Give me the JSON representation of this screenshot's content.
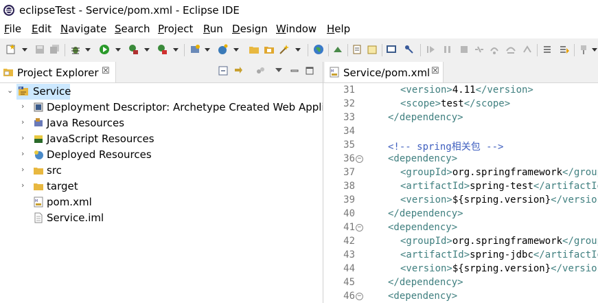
{
  "window": {
    "title": "eclipseTest - Service/pom.xml - Eclipse IDE"
  },
  "menu": [
    "File",
    "Edit",
    "Navigate",
    "Search",
    "Project",
    "Run",
    "Design",
    "Window",
    "Help"
  ],
  "project_explorer": {
    "tab_label": "Project Explorer",
    "close_glyph": "☒",
    "tree": [
      {
        "label": "Service",
        "icon": "maven-project-icon",
        "expanded": true,
        "selected": true
      },
      {
        "label": "Deployment Descriptor: Archetype Created Web Application",
        "icon": "deployment-descriptor-icon"
      },
      {
        "label": "Java Resources",
        "icon": "java-resources-icon"
      },
      {
        "label": "JavaScript Resources",
        "icon": "javascript-resources-icon"
      },
      {
        "label": "Deployed Resources",
        "icon": "deployed-resources-icon"
      },
      {
        "label": "src",
        "icon": "folder-icon"
      },
      {
        "label": "target",
        "icon": "folder-icon"
      },
      {
        "label": "pom.xml",
        "icon": "maven-file-icon"
      },
      {
        "label": "Service.iml",
        "icon": "file-icon"
      }
    ]
  },
  "editor": {
    "tab_label": "Service/pom.xml",
    "close_glyph": "☒",
    "lines": [
      {
        "num": "31",
        "fold": false,
        "indent": "  ",
        "parts": [
          [
            "tag",
            "<version>"
          ],
          [
            "txt",
            "4.11"
          ],
          [
            "tag",
            "</version>"
          ]
        ]
      },
      {
        "num": "32",
        "fold": false,
        "indent": "  ",
        "parts": [
          [
            "tag",
            "<scope>"
          ],
          [
            "txt",
            "test"
          ],
          [
            "tag",
            "</scope>"
          ]
        ]
      },
      {
        "num": "33",
        "fold": false,
        "indent": "",
        "parts": [
          [
            "tag",
            "</dependency>"
          ]
        ]
      },
      {
        "num": "34",
        "fold": false,
        "indent": "",
        "parts": []
      },
      {
        "num": "35",
        "fold": false,
        "indent": "",
        "parts": [
          [
            "cmt",
            "<!-- spring相关包 -->"
          ]
        ]
      },
      {
        "num": "36",
        "fold": true,
        "indent": "",
        "parts": [
          [
            "tag",
            "<dependency>"
          ]
        ]
      },
      {
        "num": "37",
        "fold": false,
        "indent": "  ",
        "parts": [
          [
            "tag",
            "<groupId>"
          ],
          [
            "txt",
            "org.springframework"
          ],
          [
            "tag",
            "</groupId>"
          ]
        ]
      },
      {
        "num": "38",
        "fold": false,
        "indent": "  ",
        "parts": [
          [
            "tag",
            "<artifactId>"
          ],
          [
            "txt",
            "spring-test"
          ],
          [
            "tag",
            "</artifactId>"
          ]
        ]
      },
      {
        "num": "39",
        "fold": false,
        "indent": "  ",
        "parts": [
          [
            "tag",
            "<version>"
          ],
          [
            "txt",
            "${srping.version}"
          ],
          [
            "tag",
            "</version>"
          ]
        ]
      },
      {
        "num": "40",
        "fold": false,
        "indent": "",
        "parts": [
          [
            "tag",
            "</dependency>"
          ]
        ]
      },
      {
        "num": "41",
        "fold": true,
        "indent": "",
        "parts": [
          [
            "tag",
            "<dependency>"
          ]
        ]
      },
      {
        "num": "42",
        "fold": false,
        "indent": "  ",
        "parts": [
          [
            "tag",
            "<groupId>"
          ],
          [
            "txt",
            "org.springframework"
          ],
          [
            "tag",
            "</groupId>"
          ]
        ]
      },
      {
        "num": "43",
        "fold": false,
        "indent": "  ",
        "parts": [
          [
            "tag",
            "<artifactId>"
          ],
          [
            "txt",
            "spring-jdbc"
          ],
          [
            "tag",
            "</artifactId>"
          ]
        ]
      },
      {
        "num": "44",
        "fold": false,
        "indent": "  ",
        "parts": [
          [
            "tag",
            "<version>"
          ],
          [
            "txt",
            "${srping.version}"
          ],
          [
            "tag",
            "</version>"
          ]
        ]
      },
      {
        "num": "45",
        "fold": false,
        "indent": "",
        "parts": [
          [
            "tag",
            "</dependency>"
          ]
        ]
      },
      {
        "num": "46",
        "fold": true,
        "indent": "",
        "parts": [
          [
            "tag",
            "<dependency>"
          ]
        ]
      }
    ]
  },
  "colors": {
    "xml_tag": "#3f7f7f",
    "xml_comment": "#3f5fbf",
    "selection": "#cce8ff"
  }
}
